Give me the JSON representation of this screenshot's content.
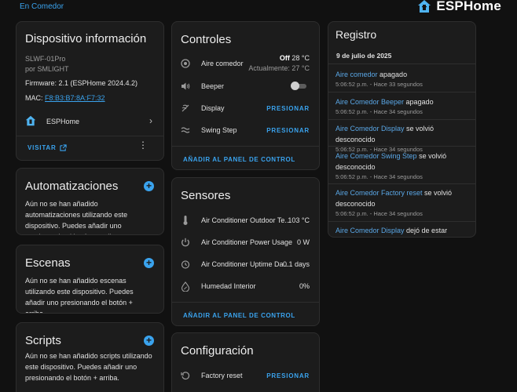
{
  "breadcrumb": "En Comedor",
  "brand": {
    "name": "ESPHome"
  },
  "device": {
    "title": "Dispositivo información",
    "model": "SLWF-01Pro",
    "manufacturer": "por SMLIGHT",
    "firmware": "Firmware: 2.1 (ESPHome 2024.4.2)",
    "mac_label": "MAC:",
    "mac_value": "F8:B3:B7:8A:F7:32",
    "integration": "ESPHome",
    "visit_label": "VISITAR"
  },
  "automations": {
    "title": "Automatizaciones",
    "text": "Aún no se han añadido automatizaciones utilizando este dispositivo. Puedes añadir uno presionando el botón + arriba."
  },
  "scenes": {
    "title": "Escenas",
    "text": "Aún no se han añadido escenas utilizando este dispositivo. Puedes añadir uno presionando el botón + arriba."
  },
  "scripts": {
    "title": "Scripts",
    "text": "Aún no se han añadido scripts utilizando este dispositivo. Puedes añadir uno presionando el botón + arriba."
  },
  "controls": {
    "title": "Controles",
    "rows": [
      {
        "label": "Aire comedor",
        "state": "Off",
        "target": "28 °C",
        "current": "Actualmente: 27 °C"
      },
      {
        "label": "Beeper"
      },
      {
        "label": "Display",
        "action": "PRESIONAR"
      },
      {
        "label": "Swing Step",
        "action": "PRESIONAR"
      }
    ],
    "add_panel": "AÑADIR AL PANEL DE CONTROL"
  },
  "sensors": {
    "title": "Sensores",
    "rows": [
      {
        "label": "Air Conditioner Outdoor Te...",
        "value": "103 °C"
      },
      {
        "label": "Air Conditioner Power Usage",
        "value": "0 W"
      },
      {
        "label": "Air Conditioner Uptime Da...",
        "value": "0.1 days"
      },
      {
        "label": "Humedad Interior",
        "value": "0%"
      }
    ],
    "add_panel": "AÑADIR AL PANEL DE CONTROL"
  },
  "config": {
    "title": "Configuración",
    "rows": [
      {
        "label": "Factory reset",
        "action": "PRESIONAR"
      }
    ]
  },
  "log": {
    "title": "Registro",
    "date": "9 de julio de 2025",
    "entries": [
      {
        "entity": "Aire comedor",
        "text": " apagado",
        "time": "5:06:52 p.m. - Hace 33 segundos"
      },
      {
        "entity": "Aire Comedor Beeper",
        "text": " apagado",
        "time": "5:06:52 p.m. - Hace 34 segundos"
      },
      {
        "entity": "Aire Comedor Display",
        "text": " se volvió desconocido",
        "time": "5:06:52 p.m. - Hace 34 segundos"
      },
      {
        "entity": "Aire Comedor Swing Step",
        "text": " se volvió desconocido",
        "time": "5:06:52 p.m. - Hace 34 segundos"
      },
      {
        "entity": "Aire Comedor Factory reset",
        "text": " se volvió desconocido",
        "time": "5:06:52 p.m. - Hace 34 segundos"
      },
      {
        "entity": "Aire Comedor Display",
        "text": " dejó de estar"
      }
    ]
  },
  "colors": {
    "accent": "#3aa3ee",
    "card": "#1c1c1c",
    "background": "#111111"
  }
}
